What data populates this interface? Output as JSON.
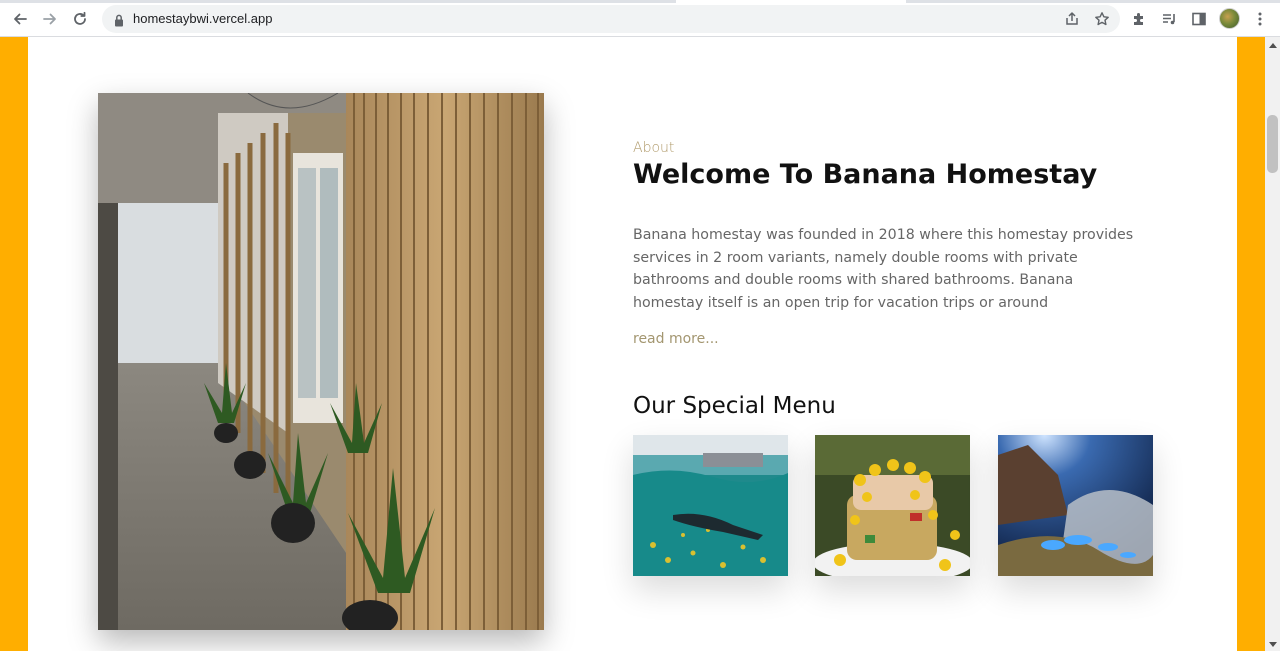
{
  "browser": {
    "url": "homestaybwi.vercel.app",
    "icons": {
      "back": "back-arrow-icon",
      "forward": "forward-arrow-icon",
      "reload": "reload-icon",
      "lock": "lock-icon",
      "share": "share-icon",
      "bookmark": "star-icon",
      "extensions": "puzzle-icon",
      "media": "media-queue-icon",
      "sidepanel": "side-panel-icon",
      "menu": "kebab-menu-icon"
    }
  },
  "page": {
    "accent_color": "#ffae00",
    "about": {
      "label": "About",
      "title": "Welcome To Banana Homestay",
      "description": "Banana homestay was founded in 2018 where this homestay provides services in 2 room variants, namely double rooms with private bathrooms and double rooms with shared bathrooms. Banana homestay itself is an open trip for vacation trips or around Banyuwangi starting from climbing",
      "read_more": "read more..."
    },
    "special_menu": {
      "title": "Our Special Menu",
      "items": [
        {
          "image": "snorkeling-photo"
        },
        {
          "image": "corn-salad-photo"
        },
        {
          "image": "blue-fire-crater-photo"
        }
      ]
    }
  }
}
